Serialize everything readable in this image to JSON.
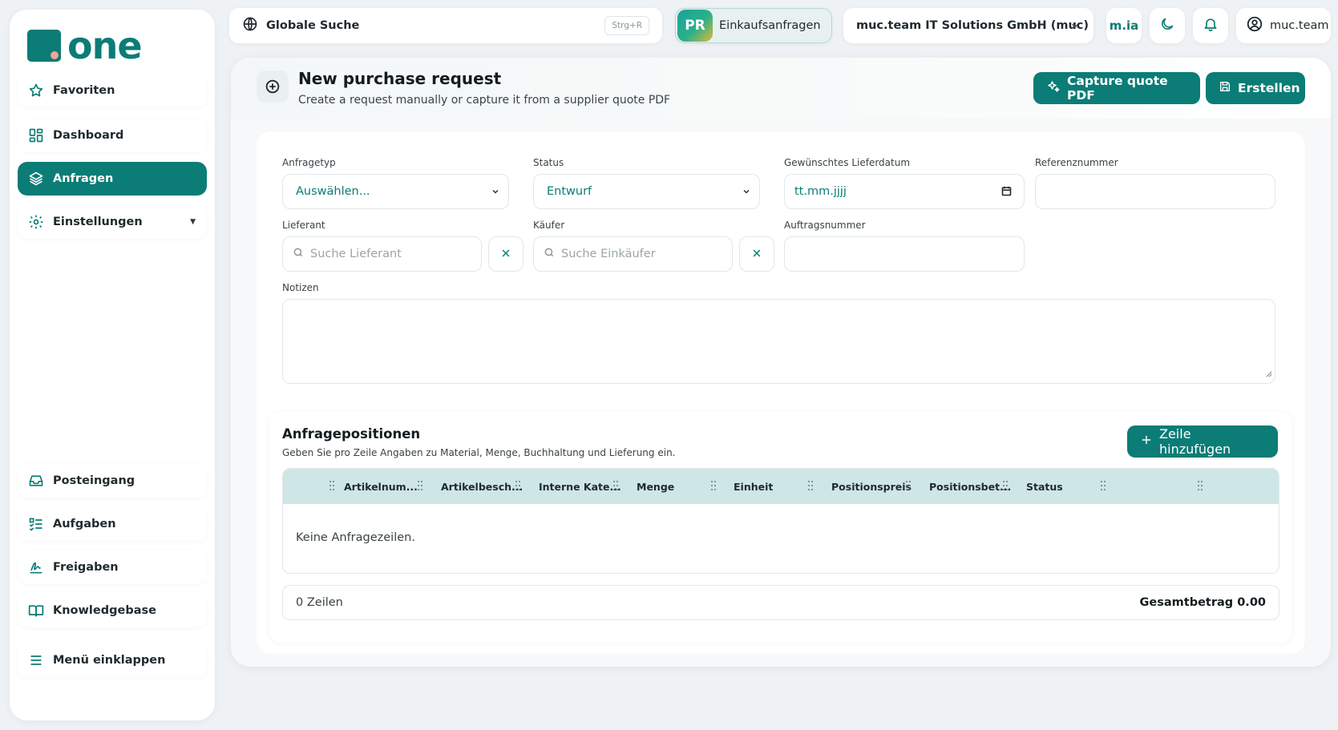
{
  "brand": {
    "name": "one",
    "color": "#0b7c76"
  },
  "sidebar": {
    "items": [
      {
        "label": "Favoriten",
        "icon": "star-icon"
      },
      {
        "label": "Dashboard",
        "icon": "dashboard-icon"
      },
      {
        "label": "Anfragen",
        "icon": "layers-icon",
        "active": true
      },
      {
        "label": "Einstellungen",
        "icon": "gear-icon",
        "caret": "▼"
      },
      {
        "label": "Posteingang",
        "icon": "inbox-icon"
      },
      {
        "label": "Aufgaben",
        "icon": "tasks-icon"
      },
      {
        "label": "Freigaben",
        "icon": "signature-icon"
      },
      {
        "label": "Knowledgebase",
        "icon": "book-icon"
      },
      {
        "label": "Menü einklappen",
        "icon": "menu-icon"
      }
    ]
  },
  "topbar": {
    "search_label": "Globale Suche",
    "search_shortcut": "Strg+R",
    "module_badge": "PR",
    "module_label": "Einkaufsanfragen",
    "company": "muc.team IT Solutions GmbH (muc)",
    "ai_label": "m.ia",
    "user": "muc.team"
  },
  "page": {
    "title": "New purchase request",
    "subtitle": "Create a request manually or capture it from a supplier quote PDF",
    "capture_button": "Capture quote PDF",
    "create_button": "Erstellen"
  },
  "form": {
    "anfragetyp": {
      "label": "Anfragetyp",
      "value": "Auswählen..."
    },
    "status": {
      "label": "Status",
      "value": "Entwurf"
    },
    "lieferdatum": {
      "label": "Gewünschtes Lieferdatum",
      "value": "tt.mm.jjjj"
    },
    "referenz": {
      "label": "Referenznummer",
      "value": ""
    },
    "lieferant": {
      "label": "Lieferant",
      "placeholder": "Suche Lieferant"
    },
    "kaeufer": {
      "label": "Käufer",
      "placeholder": "Suche Einkäufer"
    },
    "auftrag": {
      "label": "Auftragsnummer",
      "value": ""
    },
    "notizen": {
      "label": "Notizen",
      "value": ""
    }
  },
  "lines": {
    "title": "Anfragepositionen",
    "subtitle": "Geben Sie pro Zeile Angaben zu Material, Menge, Buchhaltung und Lieferung ein.",
    "add_button": "Zeile hinzufügen",
    "columns": [
      "Artikelnum...",
      "Artikelbesch...",
      "Interne Kate...",
      "Menge",
      "Einheit",
      "Positionspreis",
      "Positionsbet...",
      "Status"
    ],
    "empty": "Keine Anfragezeilen.",
    "row_count": "0 Zeilen",
    "total": "Gesamtbetrag 0.00"
  }
}
